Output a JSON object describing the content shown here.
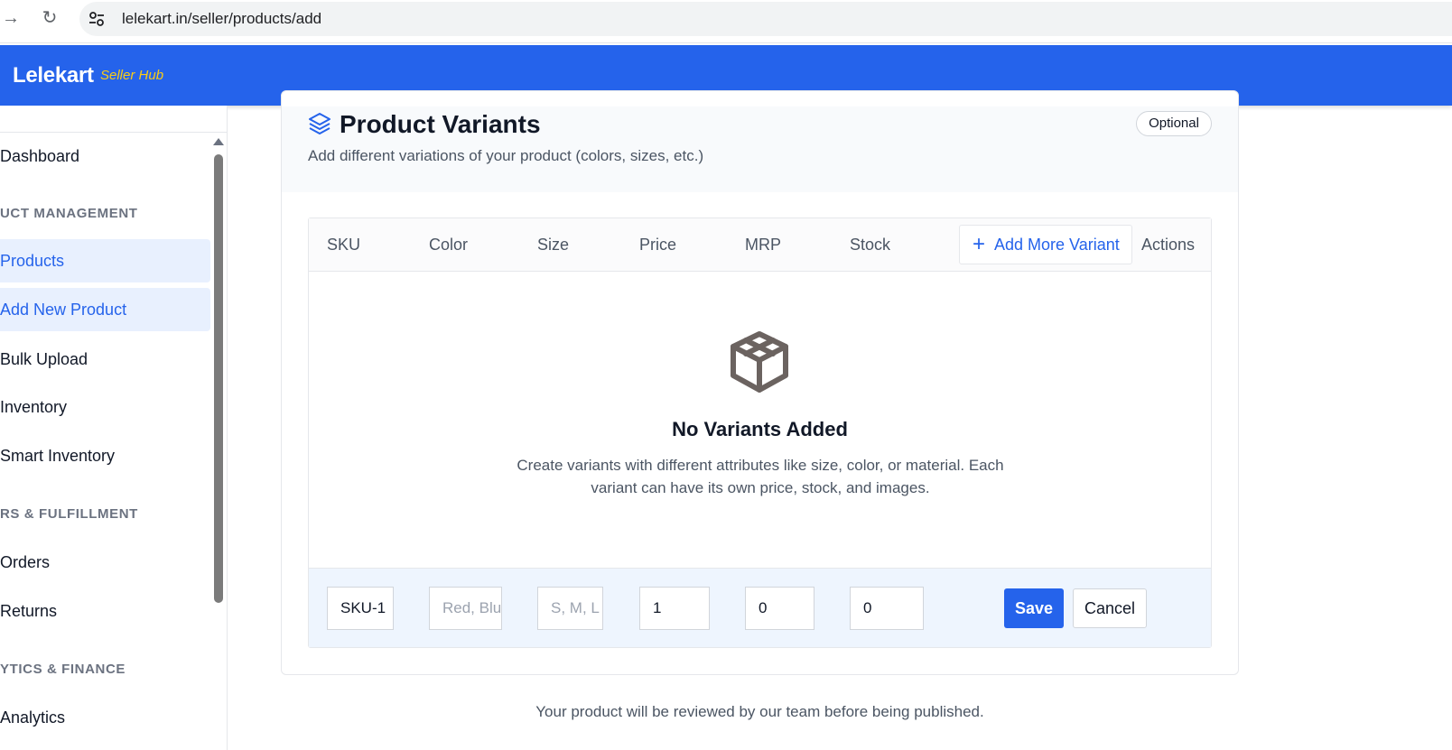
{
  "browser": {
    "url": "lelekart.in/seller/products/add"
  },
  "header": {
    "brand": "Lelekart",
    "brand_sub": "Seller Hub"
  },
  "sidebar": {
    "items": [
      {
        "label": "Dashboard"
      },
      {
        "label": "Products"
      },
      {
        "label": "Add New Product"
      },
      {
        "label": "Bulk Upload"
      },
      {
        "label": "Inventory"
      },
      {
        "label": "Smart Inventory"
      },
      {
        "label": "Orders"
      },
      {
        "label": "Returns"
      },
      {
        "label": "Analytics"
      }
    ],
    "sections": [
      {
        "label": "UCT MANAGEMENT"
      },
      {
        "label": "RS & FULFILLMENT"
      },
      {
        "label": "YTICS & FINANCE"
      }
    ]
  },
  "variants": {
    "title": "Product Variants",
    "subtitle": "Add different variations of your product (colors, sizes, etc.)",
    "badge": "Optional",
    "columns": [
      "SKU",
      "Color",
      "Size",
      "Price",
      "MRP",
      "Stock",
      "Actions"
    ],
    "add_button": "Add More Variant",
    "empty_title": "No Variants Added",
    "empty_desc": "Create variants with different attributes like size, color, or material. Each variant can have its own price, stock, and images.",
    "edit": {
      "sku_value": "SKU-1",
      "color_placeholder": "Red, Blue",
      "size_placeholder": "S, M, L",
      "price_value": "1",
      "mrp_value": "0",
      "stock_value": "0",
      "save_label": "Save",
      "cancel_label": "Cancel"
    }
  },
  "footer": {
    "note": "Your product will be reviewed by our team before being published."
  },
  "colors": {
    "primary": "#2563eb",
    "brand_accent": "#facc15"
  }
}
